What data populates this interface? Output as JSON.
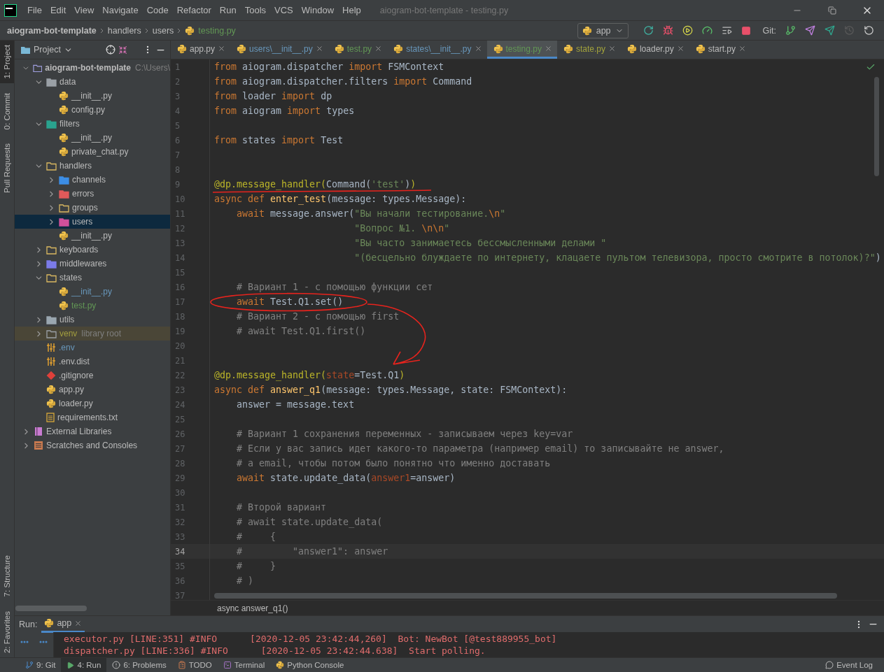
{
  "window": {
    "title": "aiogram-bot-template - testing.py"
  },
  "menu": [
    "File",
    "Edit",
    "View",
    "Navigate",
    "Code",
    "Refactor",
    "Run",
    "Tools",
    "VCS",
    "Window",
    "Help"
  ],
  "breadcrumb": [
    "aiogram-bot-template",
    "handlers",
    "users",
    "testing.py"
  ],
  "run_config": "app",
  "vcs_label": "Git:",
  "tool_strip": {
    "top": [
      {
        "label": "1: Project",
        "selected": true
      },
      {
        "label": "0: Commit",
        "selected": false
      },
      {
        "label": "Pull Requests",
        "selected": false
      }
    ],
    "bottom": [
      {
        "label": "7: Structure",
        "selected": false
      },
      {
        "label": "2: Favorites",
        "selected": false
      }
    ]
  },
  "project": {
    "title": "Project",
    "tree": [
      {
        "kind": "project",
        "label": "aiogram-bot-template",
        "hint": "C:\\Users\\",
        "expanded": true,
        "selected": false,
        "children": [
          {
            "kind": "data",
            "label": "data",
            "expanded": true,
            "selected": false,
            "children": [
              {
                "kind": "python",
                "label": "__init__.py",
                "selected": false
              },
              {
                "kind": "python",
                "label": "config.py",
                "selected": false
              }
            ]
          },
          {
            "kind": "filter",
            "label": "filters",
            "expanded": true,
            "selected": false,
            "children": [
              {
                "kind": "python",
                "label": "__init__.py",
                "selected": false
              },
              {
                "kind": "python",
                "label": "private_chat.py",
                "selected": false
              }
            ]
          },
          {
            "kind": "source",
            "label": "handlers",
            "expanded": true,
            "selected": false,
            "children": [
              {
                "kind": "channel",
                "label": "channels",
                "expanded": false,
                "selected": false
              },
              {
                "kind": "error",
                "label": "errors",
                "expanded": false,
                "selected": false
              },
              {
                "kind": "source",
                "label": "groups",
                "expanded": false,
                "selected": false
              },
              {
                "kind": "users",
                "label": "users",
                "expanded": false,
                "selected": true
              },
              {
                "kind": "python",
                "label": "__init__.py",
                "selected": false
              }
            ]
          },
          {
            "kind": "source",
            "label": "keyboards",
            "expanded": false,
            "selected": false
          },
          {
            "kind": "middleware",
            "label": "middlewares",
            "expanded": false,
            "selected": false
          },
          {
            "kind": "source",
            "label": "states",
            "expanded": true,
            "selected": false,
            "children": [
              {
                "kind": "python",
                "label": "__init__.py",
                "color": "#6897bb",
                "selected": false
              },
              {
                "kind": "python",
                "label": "test.py",
                "color": "#629755",
                "selected": false
              }
            ]
          },
          {
            "kind": "utils",
            "label": "utils",
            "expanded": false,
            "selected": false
          },
          {
            "kind": "excluded",
            "label": "venv",
            "hint": "library root",
            "color": "#a39e3f",
            "expanded": false,
            "selected": false
          },
          {
            "kind": "env",
            "label": ".env",
            "color": "#6897bb",
            "selected": false
          },
          {
            "kind": "env",
            "label": ".env.dist",
            "selected": false
          },
          {
            "kind": "git",
            "label": ".gitignore",
            "selected": false
          },
          {
            "kind": "python",
            "label": "app.py",
            "selected": false
          },
          {
            "kind": "python",
            "label": "loader.py",
            "selected": false
          },
          {
            "kind": "text",
            "label": "requirements.txt",
            "selected": false
          }
        ]
      },
      {
        "kind": "library",
        "label": "External Libraries",
        "expanded": false,
        "selected": false
      },
      {
        "kind": "scratches",
        "label": "Scratches and Consoles",
        "expanded": false,
        "selected": false
      }
    ]
  },
  "tabs": [
    {
      "label": "app.py",
      "selected": false,
      "color": "#bbbbbb"
    },
    {
      "label": "users\\__init__.py",
      "selected": false,
      "color": "#6897bb"
    },
    {
      "label": "test.py",
      "selected": false,
      "color": "#629755"
    },
    {
      "label": "states\\__init__.py",
      "selected": false,
      "color": "#6897bb"
    },
    {
      "label": "testing.py",
      "selected": true,
      "color": "#629755"
    },
    {
      "label": "state.py",
      "selected": false,
      "color": "#a3a33c"
    },
    {
      "label": "loader.py",
      "selected": false,
      "color": "#bbbbbb"
    },
    {
      "label": "start.py",
      "selected": false,
      "color": "#bbbbbb"
    }
  ],
  "editor": {
    "lines": [
      {
        "n": "1",
        "current": false,
        "tokens": [
          {
            "kind": "keyword",
            "t": "from"
          },
          {
            "kind": "plain",
            "t": " aiogram.dispatcher "
          },
          {
            "kind": "keyword",
            "t": "import"
          },
          {
            "kind": "plain",
            "t": " FSMContext"
          }
        ]
      },
      {
        "n": "2",
        "current": false,
        "tokens": [
          {
            "kind": "keyword",
            "t": "from"
          },
          {
            "kind": "plain",
            "t": " aiogram.dispatcher.filters "
          },
          {
            "kind": "keyword",
            "t": "import"
          },
          {
            "kind": "plain",
            "t": " Command"
          }
        ]
      },
      {
        "n": "3",
        "current": false,
        "tokens": [
          {
            "kind": "keyword",
            "t": "from"
          },
          {
            "kind": "plain",
            "t": " loader "
          },
          {
            "kind": "keyword",
            "t": "import"
          },
          {
            "kind": "plain",
            "t": " dp"
          }
        ]
      },
      {
        "n": "4",
        "current": false,
        "tokens": [
          {
            "kind": "keyword",
            "t": "from"
          },
          {
            "kind": "plain",
            "t": " aiogram "
          },
          {
            "kind": "keyword",
            "t": "import"
          },
          {
            "kind": "plain",
            "t": " types"
          }
        ]
      },
      {
        "n": "5",
        "current": false
      },
      {
        "n": "6",
        "current": false,
        "tokens": [
          {
            "kind": "keyword",
            "t": "from"
          },
          {
            "kind": "plain",
            "t": " states "
          },
          {
            "kind": "keyword",
            "t": "import"
          },
          {
            "kind": "plain",
            "t": " Test"
          }
        ]
      },
      {
        "n": "7",
        "current": false
      },
      {
        "n": "8",
        "current": false
      },
      {
        "n": "9",
        "current": false,
        "tokens": [
          {
            "kind": "decorator",
            "t": "@dp.message_handler("
          },
          {
            "kind": "plain",
            "t": "Command("
          },
          {
            "kind": "string",
            "t": "'test'"
          },
          {
            "kind": "plain",
            "t": ")"
          },
          {
            "kind": "decorator",
            "t": ")"
          }
        ]
      },
      {
        "n": "10",
        "current": false,
        "tokens": [
          {
            "kind": "keyword",
            "t": "async def "
          },
          {
            "kind": "function",
            "t": "enter_test"
          },
          {
            "kind": "plain",
            "t": "(message: types.Message):"
          }
        ]
      },
      {
        "n": "11",
        "current": false,
        "tokens": [
          {
            "kind": "keyword",
            "t": "    await"
          },
          {
            "kind": "plain",
            "t": " message.answer("
          },
          {
            "kind": "string",
            "t": "\"Вы начали тестирование."
          },
          {
            "kind": "escape",
            "t": "\\n"
          },
          {
            "kind": "string",
            "t": "\""
          }
        ]
      },
      {
        "n": "12",
        "current": false,
        "tokens": [
          {
            "kind": "string",
            "t": "                         \"Вопрос №1. "
          },
          {
            "kind": "escape",
            "t": "\\n\\n"
          },
          {
            "kind": "string",
            "t": "\""
          }
        ]
      },
      {
        "n": "13",
        "current": false,
        "tokens": [
          {
            "kind": "string",
            "t": "                         \"Вы часто занимаетесь бессмысленными делами \""
          }
        ]
      },
      {
        "n": "14",
        "current": false,
        "tokens": [
          {
            "kind": "string",
            "t": "                         \"(бесцельно блуждаете по интернету, клацаете пультом телевизора, просто смотрите в потолок)?\""
          },
          {
            "kind": "plain",
            "t": ")"
          }
        ]
      },
      {
        "n": "15",
        "current": false
      },
      {
        "n": "16",
        "current": false,
        "tokens": [
          {
            "kind": "comment",
            "t": "    # Вариант 1 - с помощью функции сет"
          }
        ]
      },
      {
        "n": "17",
        "current": false,
        "tokens": [
          {
            "kind": "keyword",
            "t": "    await"
          },
          {
            "kind": "plain",
            "t": " Test.Q1.set()"
          }
        ]
      },
      {
        "n": "18",
        "current": false,
        "tokens": [
          {
            "kind": "comment",
            "t": "    # Вариант 2 - с помощью first"
          }
        ]
      },
      {
        "n": "19",
        "current": false,
        "tokens": [
          {
            "kind": "comment",
            "t": "    # await Test.Q1.first()"
          }
        ]
      },
      {
        "n": "20",
        "current": false
      },
      {
        "n": "21",
        "current": false
      },
      {
        "n": "22",
        "current": false,
        "tokens": [
          {
            "kind": "decorator",
            "t": "@dp.message_handler("
          },
          {
            "kind": "parameter",
            "t": "state"
          },
          {
            "kind": "plain",
            "t": "=Test.Q1"
          },
          {
            "kind": "decorator",
            "t": ")"
          }
        ]
      },
      {
        "n": "23",
        "current": false,
        "tokens": [
          {
            "kind": "keyword",
            "t": "async def "
          },
          {
            "kind": "function",
            "t": "answer_q1"
          },
          {
            "kind": "plain",
            "t": "(message: types.Message, state: FSMContext):"
          }
        ]
      },
      {
        "n": "24",
        "current": false,
        "tokens": [
          {
            "kind": "plain",
            "t": "    answer = message.text"
          }
        ]
      },
      {
        "n": "25",
        "current": false
      },
      {
        "n": "26",
        "current": false,
        "tokens": [
          {
            "kind": "comment",
            "t": "    # Вариант 1 сохранения переменных - записываем через key=var"
          }
        ]
      },
      {
        "n": "27",
        "current": false,
        "tokens": [
          {
            "kind": "comment",
            "t": "    # Если у вас запись идет какого-то параметра (например email) то записывайте не answer,"
          }
        ]
      },
      {
        "n": "28",
        "current": false,
        "tokens": [
          {
            "kind": "comment",
            "t": "    # а email, чтобы потом было понятно что именно доставать"
          }
        ]
      },
      {
        "n": "29",
        "current": false,
        "tokens": [
          {
            "kind": "keyword",
            "t": "    await"
          },
          {
            "kind": "plain",
            "t": " state.update_data("
          },
          {
            "kind": "parameter",
            "t": "answer1"
          },
          {
            "kind": "plain",
            "t": "=answer)"
          }
        ]
      },
      {
        "n": "30",
        "current": false
      },
      {
        "n": "31",
        "current": false,
        "tokens": [
          {
            "kind": "comment",
            "t": "    # Второй вариант"
          }
        ]
      },
      {
        "n": "32",
        "current": false,
        "tokens": [
          {
            "kind": "comment",
            "t": "    # await state.update_data("
          }
        ]
      },
      {
        "n": "33",
        "current": false,
        "tokens": [
          {
            "kind": "comment",
            "t": "    #     {"
          }
        ]
      },
      {
        "n": "34",
        "current": true,
        "tokens": [
          {
            "kind": "comment",
            "t": "    #         \"answer1\": answer"
          }
        ]
      },
      {
        "n": "35",
        "current": false,
        "tokens": [
          {
            "kind": "comment",
            "t": "    #     }"
          }
        ]
      },
      {
        "n": "36",
        "current": false,
        "tokens": [
          {
            "kind": "comment",
            "t": "    # )"
          }
        ]
      },
      {
        "n": "37",
        "current": false
      }
    ],
    "annotations": [
      {
        "kind": "underline"
      },
      {
        "kind": "circle"
      },
      {
        "kind": "arrow"
      }
    ],
    "footer": "async answer_q1()"
  },
  "run_panel": {
    "label": "Run:",
    "tab": "app",
    "log": [
      "executor.py [LINE:351] #INFO      [2020-12-05 23:42:44,260]  Bot: NewBot [@test889955_bot]",
      "dispatcher.py [LINE:336] #INFO      [2020-12-05 23:42:44.638]  Start polling."
    ]
  },
  "status_bar": [
    {
      "kind": "git",
      "label": "9: Git",
      "selected": false
    },
    {
      "kind": "run",
      "label": "4: Run",
      "selected": true
    },
    {
      "kind": "problems",
      "label": "6: Problems",
      "selected": false
    },
    {
      "kind": "todo",
      "label": "TODO",
      "selected": false
    },
    {
      "kind": "terminal",
      "label": "Terminal",
      "selected": false
    },
    {
      "kind": "console",
      "label": "Python Console",
      "selected": false
    }
  ],
  "event_log": "Event Log"
}
